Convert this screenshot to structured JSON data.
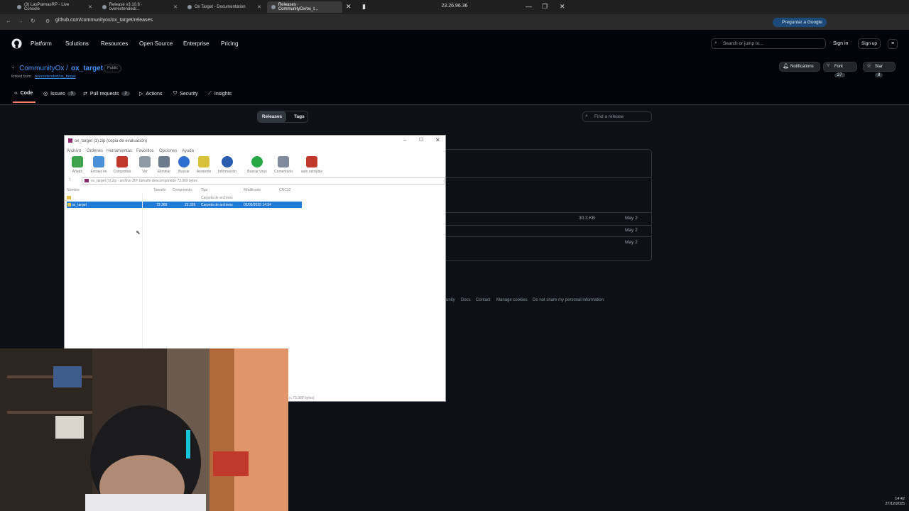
{
  "browser": {
    "tabs": [
      {
        "label": "(3) LasPalmasRP - Live Console"
      },
      {
        "label": "Release v3.10.6 · overextended/..."
      },
      {
        "label": "Ox Target - Documentation"
      },
      {
        "label": "Releases · CommunityOx/ox_t..."
      }
    ],
    "remote_ip": "23.26.96.36",
    "url": "github.com/communityox/ox_target/releases",
    "google_button": "Preguntar a Google"
  },
  "github": {
    "nav": [
      "Platform",
      "Solutions",
      "Resources",
      "Open Source",
      "Enterprise",
      "Pricing"
    ],
    "search_placeholder": "Search or jump to...",
    "sign_in": "Sign in",
    "sign_up": "Sign up",
    "repo_owner": "CommunityOx",
    "repo_name": "ox_target",
    "visibility": "Public",
    "forked_label": "forked from",
    "forked_from": "overextended/ox_target",
    "notifications": "Notifications",
    "fork_label": "Fork",
    "fork_count": "27",
    "star_label": "Star",
    "star_count": "8",
    "tabs": [
      {
        "label": "Code",
        "count": ""
      },
      {
        "label": "Issues",
        "count": "3"
      },
      {
        "label": "Pull requests",
        "count": "2"
      },
      {
        "label": "Actions",
        "count": ""
      },
      {
        "label": "Security",
        "count": ""
      },
      {
        "label": "Insights",
        "count": ""
      }
    ],
    "releases_tab": "Releases",
    "tags_tab": "Tags",
    "find_release_placeholder": "Find a release",
    "assets": [
      {
        "size": "30.3 KB",
        "date": "May 2"
      },
      {
        "size": "",
        "date": "May 2"
      },
      {
        "size": "",
        "date": "May 2"
      }
    ],
    "footer": [
      "unity",
      "Docs",
      "Contact",
      "Manage cookies",
      "Do not share my personal information"
    ]
  },
  "winrar": {
    "title": "ox_target (1).zip (copia de evaluación)",
    "menu": [
      "Archivo",
      "Órdenes",
      "Herramientas",
      "Favoritos",
      "Opciones",
      "Ayuda"
    ],
    "toolbar": [
      {
        "label": "Añadir",
        "color": "#3fa34d"
      },
      {
        "label": "Extraer en",
        "color": "#4a90d9"
      },
      {
        "label": "Comprobar",
        "color": "#c0392b"
      },
      {
        "label": "Ver",
        "color": "#8e9aa6"
      },
      {
        "label": "Eliminar",
        "color": "#6b7b8c"
      },
      {
        "label": "Buscar",
        "color": "#2e6fd0"
      },
      {
        "label": "Asistente",
        "color": "#d9c23a"
      },
      {
        "label": "Información",
        "color": "#2a5db0"
      },
      {
        "label": "Buscar virus",
        "color": "#27a844"
      },
      {
        "label": "Comentario",
        "color": "#7f8c9d"
      },
      {
        "label": "auto extraíble",
        "color": "#c0392b"
      }
    ],
    "path": "ox_target (1).zip - archivo ZIP, tamaño descomprimido 73.369 bytes",
    "columns": [
      "Nombre",
      "Tamaño",
      "Comprimido",
      "Tipo",
      "Modificado",
      "CRC32"
    ],
    "parent_row_type": "Carpeta de archivos",
    "selected_row": {
      "name": "ox_target",
      "size": "73.369",
      "packed": "22.326",
      "type": "Carpeta de archivos",
      "modified": "02/05/2025 14:54"
    },
    "status": "s, 73.369 bytes)"
  },
  "tray": {
    "time": "14:42",
    "date": "27/12/2025"
  }
}
